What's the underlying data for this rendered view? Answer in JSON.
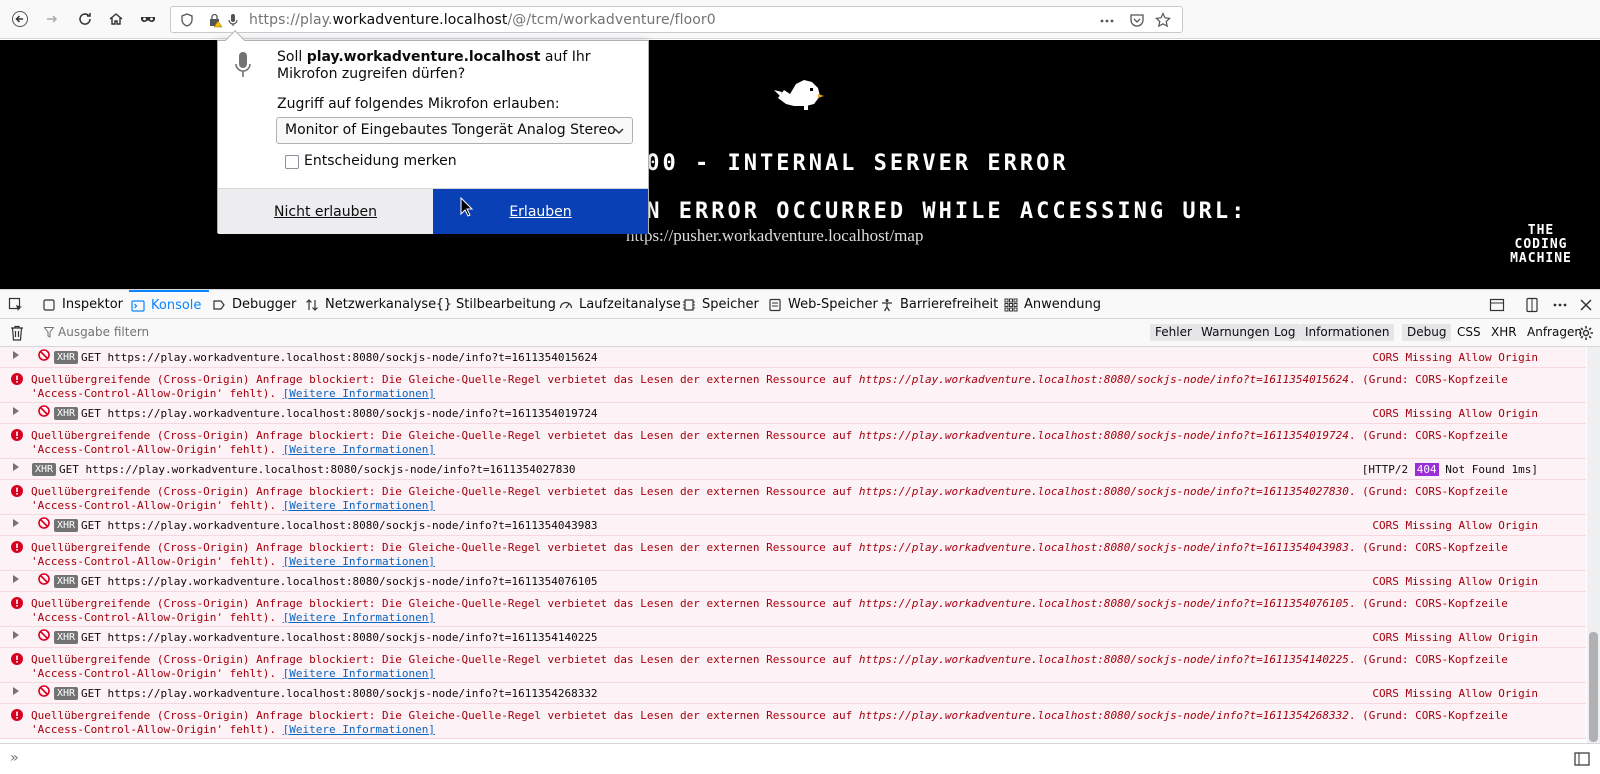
{
  "browser": {
    "url_prefix": "https://play.",
    "url_host": "workadventure.localhost",
    "url_suffix": "/@/tcm/workadventure/floor0"
  },
  "page": {
    "error_title": "500 - INTERNAL SERVER ERROR",
    "error_subtitle": "AN ERROR OCCURRED WHILE ACCESSING URL:",
    "error_url": "https://pusher.workadventure.localhost/map",
    "logo_lines": [
      "THE",
      "CODING",
      "MACHINE"
    ]
  },
  "popup": {
    "msg_prefix": "Soll ",
    "msg_host": "play.workadventure.localhost",
    "msg_suffix": " auf Ihr Mikrofon zugreifen dürfen?",
    "select_label": "Zugriff auf folgendes Mikrofon erlauben:",
    "select_value": "Monitor of Eingebautes Tongerät Analog Stereo",
    "remember_label": "Entscheidung merken",
    "deny_label": "Nicht erlauben",
    "allow_label": "Erlauben"
  },
  "devtools": {
    "tabs": [
      {
        "label": "Inspektor",
        "icon": "inspector-icon"
      },
      {
        "label": "Konsole",
        "icon": "console-icon"
      },
      {
        "label": "Debugger",
        "icon": "debugger-icon"
      },
      {
        "label": "Netzwerkanalyse",
        "icon": "network-icon"
      },
      {
        "label": "Stilbearbeitung",
        "icon": "style-editor-icon"
      },
      {
        "label": "Laufzeitanalyse",
        "icon": "performance-icon"
      },
      {
        "label": "Speicher",
        "icon": "memory-icon"
      },
      {
        "label": "Web-Speicher",
        "icon": "storage-icon"
      },
      {
        "label": "Barrierefreiheit",
        "icon": "accessibility-icon"
      },
      {
        "label": "Anwendung",
        "icon": "application-icon"
      }
    ],
    "filter_placeholder": "Ausgabe filtern",
    "filters": [
      "Fehler",
      "Warnungen",
      "Log",
      "Informationen",
      "Debug"
    ],
    "filters_extra": [
      "CSS",
      "XHR",
      "Anfragen"
    ],
    "prompt": "»"
  },
  "console": {
    "xhr_badge": "XHR",
    "more_info": "[Weitere Informationen]",
    "err_a": "Quellübergreifende (Cross-Origin) Anfrage blockiert: Die Gleiche-Quelle-Regel verbietet das Lesen der externen Ressource auf ",
    "err_b": ". (Grund: CORS-Kopfzeile 'Access-Control-Allow-Origin' fehlt). ",
    "requests": [
      {
        "text": "GET https://play.workadventure.localhost:8080/sockjs-node/info?t=1611354015624",
        "url": "https://play.workadventure.localhost:8080/sockjs-node/info?t=1611354015624",
        "status": "CORS Missing Allow Origin",
        "blocked": true
      },
      {
        "text": "GET https://play.workadventure.localhost:8080/sockjs-node/info?t=1611354019724",
        "url": "https://play.workadventure.localhost:8080/sockjs-node/info?t=1611354019724",
        "status": "CORS Missing Allow Origin",
        "blocked": true
      },
      {
        "text": "GET https://play.workadventure.localhost:8080/sockjs-node/info?t=1611354027830",
        "url": "https://play.workadventure.localhost:8080/sockjs-node/info?t=1611354027830",
        "status_a": "[HTTP/2 ",
        "status_code": "404",
        "status_b": " Not Found 1ms]",
        "blocked": false
      },
      {
        "text": "GET https://play.workadventure.localhost:8080/sockjs-node/info?t=1611354043983",
        "url": "https://play.workadventure.localhost:8080/sockjs-node/info?t=1611354043983",
        "status": "CORS Missing Allow Origin",
        "blocked": true
      },
      {
        "text": "GET https://play.workadventure.localhost:8080/sockjs-node/info?t=1611354076105",
        "url": "https://play.workadventure.localhost:8080/sockjs-node/info?t=1611354076105",
        "status": "CORS Missing Allow Origin",
        "blocked": true
      },
      {
        "text": "GET https://play.workadventure.localhost:8080/sockjs-node/info?t=1611354140225",
        "url": "https://play.workadventure.localhost:8080/sockjs-node/info?t=1611354140225",
        "status": "CORS Missing Allow Origin",
        "blocked": true
      },
      {
        "text": "GET https://play.workadventure.localhost:8080/sockjs-node/info?t=1611354268332",
        "url": "https://play.workadventure.localhost:8080/sockjs-node/info?t=1611354268332",
        "status": "CORS Missing Allow Origin",
        "blocked": true
      }
    ]
  }
}
